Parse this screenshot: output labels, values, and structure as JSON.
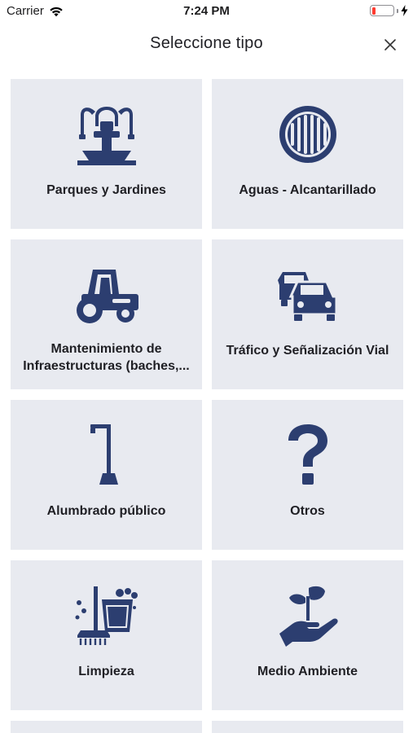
{
  "status_bar": {
    "carrier": "Carrier",
    "time": "7:24 PM"
  },
  "header": {
    "title": "Seleccione tipo"
  },
  "colors": {
    "icon": "#2c3e70",
    "card": "#e8eaf0",
    "battery_low": "#ff3b30"
  },
  "categories": [
    {
      "label": "Parques y Jardines",
      "icon": "fountain-icon"
    },
    {
      "label": "Aguas - Alcantarillado",
      "icon": "sewer-grate-icon"
    },
    {
      "label": "Mantenimiento de Infraestructuras (baches,...",
      "icon": "road-roller-icon"
    },
    {
      "label": "Tráfico y Señalización Vial",
      "icon": "traffic-cars-icon"
    },
    {
      "label": "Alumbrado público",
      "icon": "street-lamp-icon"
    },
    {
      "label": "Otros",
      "icon": "question-mark-icon"
    },
    {
      "label": "Limpieza",
      "icon": "cleaning-bucket-icon"
    },
    {
      "label": "Medio Ambiente",
      "icon": "plant-hand-icon"
    }
  ]
}
